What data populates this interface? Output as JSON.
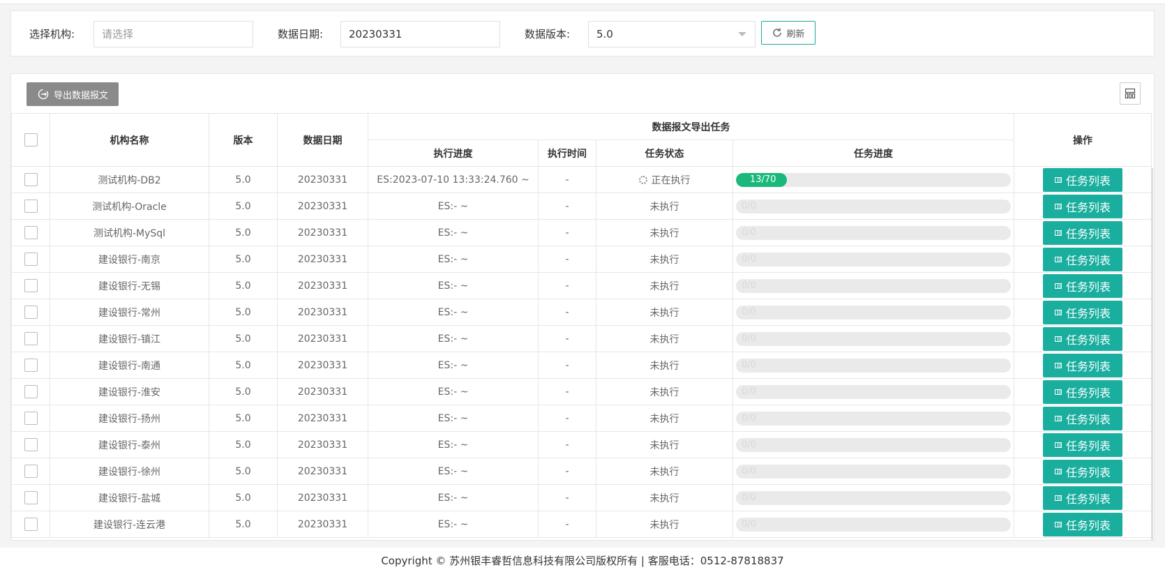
{
  "filters": {
    "org_label": "选择机构:",
    "org_placeholder": "请选择",
    "date_label": "数据日期:",
    "date_value": "20230331",
    "version_label": "数据版本:",
    "version_value": "5.0",
    "refresh_label": "刷新"
  },
  "toolbar": {
    "export_label": "导出数据报文"
  },
  "table": {
    "headers": {
      "org_name": "机构名称",
      "version": "版本",
      "data_date": "数据日期",
      "group": "数据报文导出任务",
      "exec_progress": "执行进度",
      "exec_time": "执行时间",
      "task_status": "任务状态",
      "task_progress": "任务进度",
      "action": "操作"
    },
    "rows": [
      {
        "org": "测试机构-DB2",
        "version": "5.0",
        "date": "20230331",
        "exec_progress": "ES:2023-07-10 13:33:24.760 ~",
        "exec_time": "-",
        "status": "正在执行",
        "progress": "13/70",
        "done": 13,
        "total": 70,
        "action": "任务列表"
      },
      {
        "org": "测试机构-Oracle",
        "version": "5.0",
        "date": "20230331",
        "exec_progress": "ES:- ~",
        "exec_time": "-",
        "status": "未执行",
        "progress": "0/0",
        "done": 0,
        "total": 0,
        "action": "任务列表"
      },
      {
        "org": "测试机构-MySql",
        "version": "5.0",
        "date": "20230331",
        "exec_progress": "ES:- ~",
        "exec_time": "-",
        "status": "未执行",
        "progress": "0/0",
        "done": 0,
        "total": 0,
        "action": "任务列表"
      },
      {
        "org": "建设银行-南京",
        "version": "5.0",
        "date": "20230331",
        "exec_progress": "ES:- ~",
        "exec_time": "-",
        "status": "未执行",
        "progress": "0/0",
        "done": 0,
        "total": 0,
        "action": "任务列表"
      },
      {
        "org": "建设银行-无锡",
        "version": "5.0",
        "date": "20230331",
        "exec_progress": "ES:- ~",
        "exec_time": "-",
        "status": "未执行",
        "progress": "0/0",
        "done": 0,
        "total": 0,
        "action": "任务列表"
      },
      {
        "org": "建设银行-常州",
        "version": "5.0",
        "date": "20230331",
        "exec_progress": "ES:- ~",
        "exec_time": "-",
        "status": "未执行",
        "progress": "0/0",
        "done": 0,
        "total": 0,
        "action": "任务列表"
      },
      {
        "org": "建设银行-镇江",
        "version": "5.0",
        "date": "20230331",
        "exec_progress": "ES:- ~",
        "exec_time": "-",
        "status": "未执行",
        "progress": "0/0",
        "done": 0,
        "total": 0,
        "action": "任务列表"
      },
      {
        "org": "建设银行-南通",
        "version": "5.0",
        "date": "20230331",
        "exec_progress": "ES:- ~",
        "exec_time": "-",
        "status": "未执行",
        "progress": "0/0",
        "done": 0,
        "total": 0,
        "action": "任务列表"
      },
      {
        "org": "建设银行-淮安",
        "version": "5.0",
        "date": "20230331",
        "exec_progress": "ES:- ~",
        "exec_time": "-",
        "status": "未执行",
        "progress": "0/0",
        "done": 0,
        "total": 0,
        "action": "任务列表"
      },
      {
        "org": "建设银行-扬州",
        "version": "5.0",
        "date": "20230331",
        "exec_progress": "ES:- ~",
        "exec_time": "-",
        "status": "未执行",
        "progress": "0/0",
        "done": 0,
        "total": 0,
        "action": "任务列表"
      },
      {
        "org": "建设银行-泰州",
        "version": "5.0",
        "date": "20230331",
        "exec_progress": "ES:- ~",
        "exec_time": "-",
        "status": "未执行",
        "progress": "0/0",
        "done": 0,
        "total": 0,
        "action": "任务列表"
      },
      {
        "org": "建设银行-徐州",
        "version": "5.0",
        "date": "20230331",
        "exec_progress": "ES:- ~",
        "exec_time": "-",
        "status": "未执行",
        "progress": "0/0",
        "done": 0,
        "total": 0,
        "action": "任务列表"
      },
      {
        "org": "建设银行-盐城",
        "version": "5.0",
        "date": "20230331",
        "exec_progress": "ES:- ~",
        "exec_time": "-",
        "status": "未执行",
        "progress": "0/0",
        "done": 0,
        "total": 0,
        "action": "任务列表"
      },
      {
        "org": "建设银行-连云港",
        "version": "5.0",
        "date": "20230331",
        "exec_progress": "ES:- ~",
        "exec_time": "-",
        "status": "未执行",
        "progress": "0/0",
        "done": 0,
        "total": 0,
        "action": "任务列表"
      }
    ]
  },
  "footer": {
    "text": "Copyright © 苏州银丰睿哲信息科技有限公司版权所有 | 客服电话：0512-87818837"
  },
  "colors": {
    "accent": "#1aae9f",
    "progress_fill": "#1bb87b",
    "export_button": "#8a8a8a"
  },
  "icons": {
    "refresh": "refresh-icon",
    "export": "export-icon",
    "columns": "columns-icon",
    "task_list": "grid-icon",
    "running": "spinner-icon"
  }
}
